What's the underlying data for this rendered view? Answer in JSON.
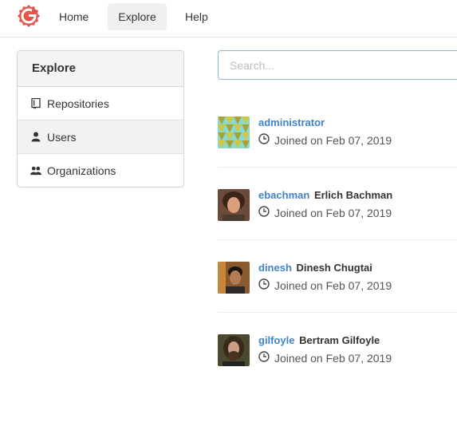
{
  "nav": {
    "home": "Home",
    "explore": "Explore",
    "help": "Help",
    "logo_icon": "gitea-logo-icon"
  },
  "sidebar": {
    "title": "Explore",
    "items": [
      {
        "label": "Repositories",
        "icon": "book-icon",
        "active": false
      },
      {
        "label": "Users",
        "icon": "user-icon",
        "active": true
      },
      {
        "label": "Organizations",
        "icon": "organization-icon",
        "active": false
      }
    ]
  },
  "search": {
    "placeholder": "Search..."
  },
  "users": [
    {
      "username": "administrator",
      "full_name": "",
      "joined": "Joined on Feb 07, 2019"
    },
    {
      "username": "ebachman",
      "full_name": "Erlich Bachman",
      "joined": "Joined on Feb 07, 2019"
    },
    {
      "username": "dinesh",
      "full_name": "Dinesh Chugtai",
      "joined": "Joined on Feb 07, 2019"
    },
    {
      "username": "gilfoyle",
      "full_name": "Bertram Gilfoyle",
      "joined": "Joined on Feb 07, 2019"
    }
  ],
  "colors": {
    "accent": "#4183c4",
    "logo": "#e4554a",
    "active_bg": "#f0f0f0"
  }
}
